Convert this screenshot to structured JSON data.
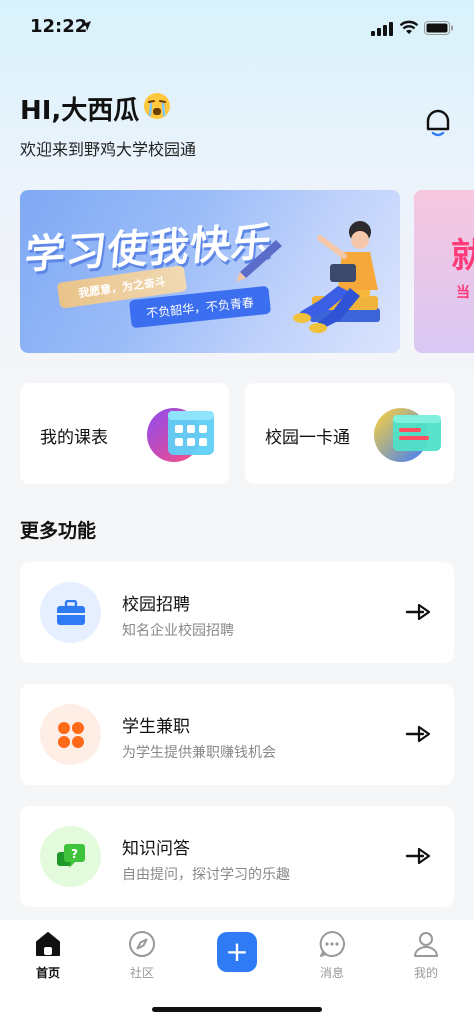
{
  "status_bar": {
    "time": "12:22"
  },
  "header": {
    "greeting": "HI,大西瓜",
    "welcome": "欢迎来到野鸡大学校园通"
  },
  "banner": {
    "title": "学习使我快乐",
    "tag_gold": "我愿意，为之奋斗",
    "tag_blue": "不负韶华，不负青春",
    "peek_char": "就",
    "peek_char2": "当"
  },
  "quick_cards": [
    {
      "label": "我的课表",
      "icon": "schedule-icon"
    },
    {
      "label": "校园一卡通",
      "icon": "campus-card-icon"
    }
  ],
  "section_title": "更多功能",
  "features": [
    {
      "title": "校园招聘",
      "subtitle": "知名企业校园招聘",
      "icon": "briefcase-icon",
      "icon_bg": "#e5efff",
      "icon_color": "#2f7bf5"
    },
    {
      "title": "学生兼职",
      "subtitle": "为学生提供兼职赚钱机会",
      "icon": "clover-icon",
      "icon_bg": "#ffeee5",
      "icon_color": "#ff6a1a"
    },
    {
      "title": "知识问答",
      "subtitle": "自由提问，探讨学习的乐趣",
      "icon": "qa-chat-icon",
      "icon_bg": "#e3fadc",
      "icon_color": "#3fc33a"
    }
  ],
  "tabbar": {
    "items": [
      {
        "label": "首页",
        "icon": "home-icon",
        "active": true
      },
      {
        "label": "社区",
        "icon": "compass-icon",
        "active": false
      },
      {
        "label": "",
        "icon": "plus-icon",
        "active": false
      },
      {
        "label": "消息",
        "icon": "message-icon",
        "active": false
      },
      {
        "label": "我的",
        "icon": "profile-icon",
        "active": false
      }
    ],
    "plus_symbol": "+"
  },
  "colors": {
    "accent": "#2f7bf5",
    "background": "#f5f6f8"
  }
}
